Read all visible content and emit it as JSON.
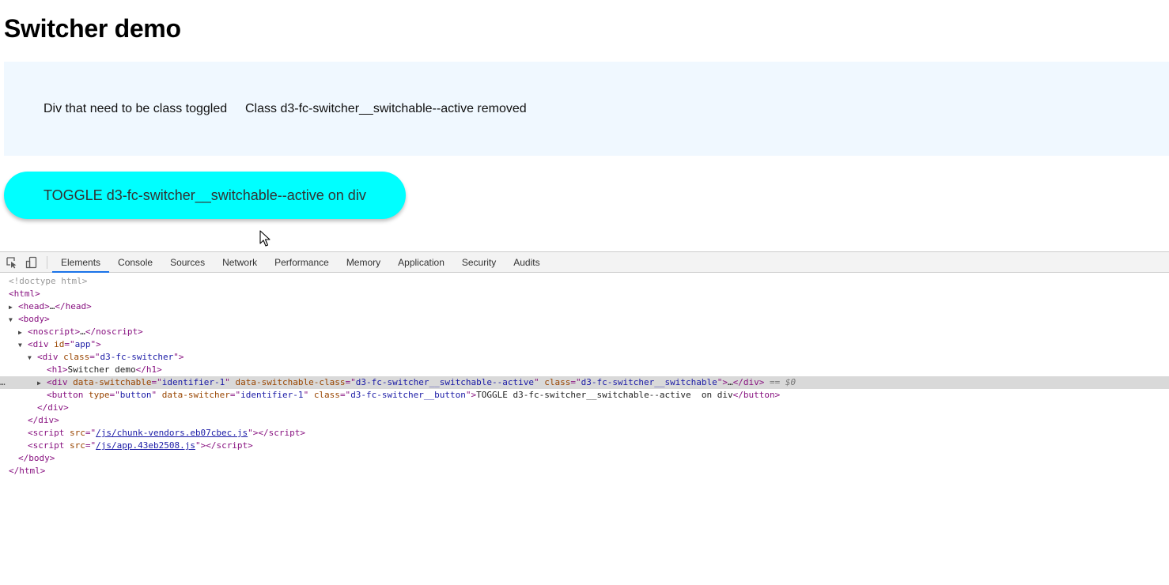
{
  "page": {
    "title": "Switcher demo",
    "switchable_label": "Div that need to be class toggled",
    "status_text": "Class d3-fc-switcher__switchable--active removed",
    "toggle_button_label": "TOGGLE d3-fc-switcher__switchable--active on div"
  },
  "devtools": {
    "tabs": [
      "Elements",
      "Console",
      "Sources",
      "Network",
      "Performance",
      "Memory",
      "Application",
      "Security",
      "Audits"
    ],
    "active_tab": "Elements",
    "tree": {
      "doctype": "<!doctype html>",
      "html_open": "<html>",
      "head": "head",
      "head_ellipsis": "…",
      "body": "body",
      "noscript": "noscript",
      "div_app_tag": "div",
      "id_attr": "id",
      "id_val": "app",
      "switcher_class_attr": "class",
      "switcher_class_val": "d3-fc-switcher",
      "h1_text": "Switcher demo",
      "switchable_attr1": "data-switchable",
      "switchable_val1": "identifier-1",
      "switchable_attr2": "data-switchable-class",
      "switchable_val2": "d3-fc-switcher__switchable--active",
      "switchable_attr3": "class",
      "switchable_val3": "d3-fc-switcher__switchable",
      "selected_marker": "== $0",
      "button_attr1": "type",
      "button_val1": "button",
      "button_attr2": "data-switcher",
      "button_val2": "identifier-1",
      "button_attr3": "class",
      "button_val3": "d3-fc-switcher__button",
      "button_text": "TOGGLE d3-fc-switcher__switchable--active  on div",
      "script1_src": "/js/chunk-vendors.eb07cbec.js",
      "script2_src": "/js/app.43eb2508.js"
    }
  },
  "colors": {
    "switchable_bg": "#f0f8ff",
    "button_bg": "#00ffff",
    "active_tab_underline": "#1a73e8",
    "tag_color": "#881280",
    "attr_color": "#994500",
    "value_color": "#1a1aa6"
  },
  "icons": [
    "inspect-element-icon",
    "device-toolbar-icon",
    "mouse-pointer-icon"
  ]
}
